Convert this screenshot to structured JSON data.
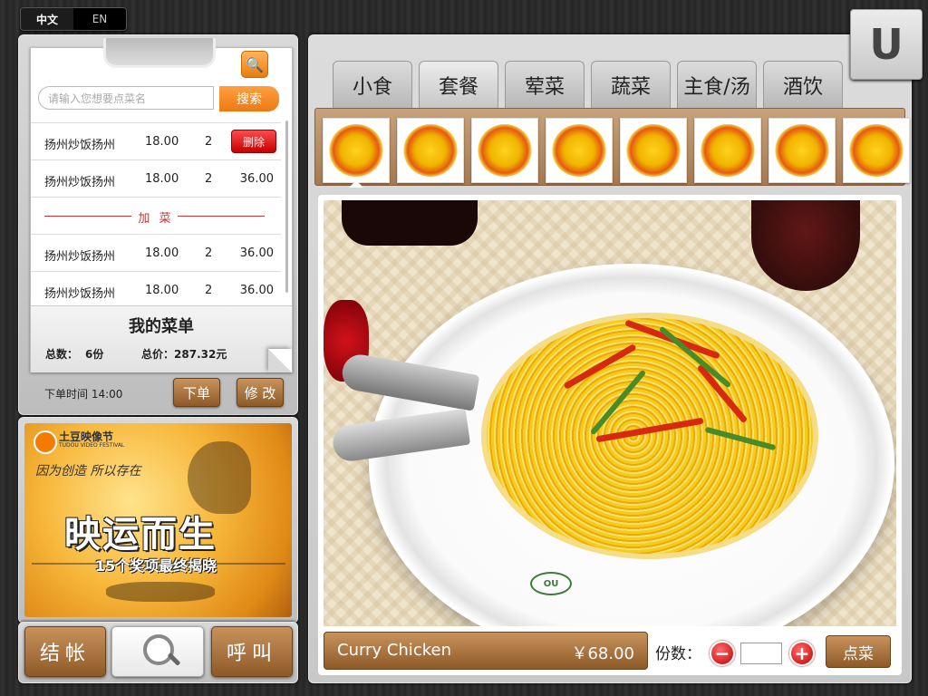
{
  "language": {
    "zh": "中文",
    "en": "EN"
  },
  "search": {
    "placeholder": "请输入您想要点菜名",
    "button": "搜索"
  },
  "order_items": [
    {
      "name": "扬州炒饭扬州",
      "price": "18.00",
      "qty": "2",
      "action": "删除"
    },
    {
      "name": "扬州炒饭扬州",
      "price": "18.00",
      "qty": "2",
      "total": "36.00"
    }
  ],
  "add_dish_separator": "加 菜",
  "added_items": [
    {
      "name": "扬州炒饭扬州",
      "price": "18.00",
      "qty": "2",
      "total": "36.00"
    },
    {
      "name": "扬州炒饭扬州",
      "price": "18.00",
      "qty": "2",
      "total": "36.00"
    }
  ],
  "my_menu": {
    "title": "我的菜单",
    "count_label": "总数：",
    "count_value": "6份",
    "sum_label": "总价：",
    "sum_value": "287.32元"
  },
  "order_time": "下单时间 14:00",
  "actions": {
    "place_order": "下单",
    "modify": "修 改"
  },
  "ad": {
    "brand": "土豆映像节",
    "brand_en": "TUDOU VIDEO FESTIVAL",
    "slogan": "因为创造 所以存在",
    "headline": "映运而生",
    "subline": "15个奖项最终揭晓"
  },
  "bottom_buttons": {
    "checkout": "结帐",
    "call": "呼叫"
  },
  "tabs": [
    {
      "label": "小食",
      "active": false
    },
    {
      "label": "套餐",
      "active": true
    },
    {
      "label": "荤菜",
      "active": false
    },
    {
      "label": "蔬菜",
      "active": false
    },
    {
      "label": "主食/汤",
      "active": false
    },
    {
      "label": "酒饮",
      "active": false
    }
  ],
  "thumbnails_count_label": "",
  "dish": {
    "name": "Curry Chicken",
    "price": "￥68.00"
  },
  "quantity": {
    "label": "份数：",
    "minus": "−",
    "plus": "+"
  },
  "order_dish_button": "点菜",
  "plate_logo": "OU",
  "brand_logo": "U",
  "colors": {
    "accent_brown": "#8d5a28",
    "accent_orange": "#ec7a12",
    "delete_red": "#c50000",
    "separator_red": "#cc3333"
  }
}
